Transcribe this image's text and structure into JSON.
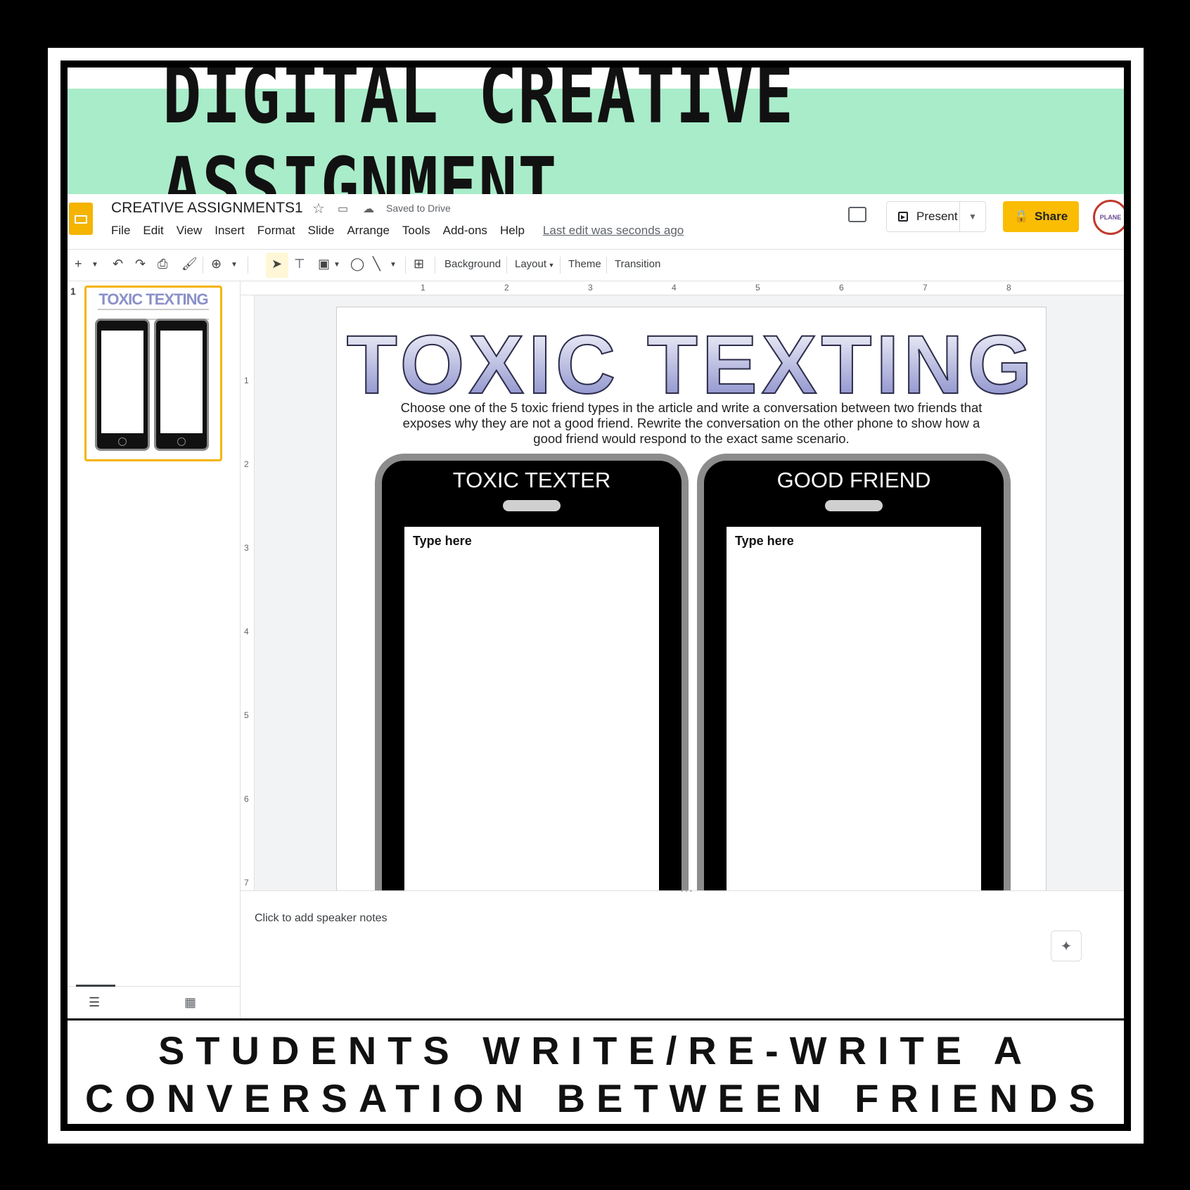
{
  "banner": {
    "title": "DIGITAL CREATIVE ASSIGNMENT"
  },
  "app": {
    "doc_title": "CREATIVE ASSIGNMENTS1",
    "saved_status": "Saved to Drive",
    "menu": [
      "File",
      "Edit",
      "View",
      "Insert",
      "Format",
      "Slide",
      "Arrange",
      "Tools",
      "Add-ons",
      "Help"
    ],
    "last_edit": "Last edit was seconds ago",
    "present_label": "Present",
    "share_label": "Share",
    "avatar_text": "PLANE",
    "toolbar": {
      "background": "Background",
      "layout": "Layout",
      "theme": "Theme",
      "transition": "Transition"
    },
    "ruler_h": [
      "1",
      "2",
      "3",
      "4",
      "5",
      "6",
      "7",
      "8"
    ],
    "ruler_v": [
      "1",
      "2",
      "3",
      "4",
      "5",
      "6",
      "7"
    ],
    "filmstrip": {
      "slide_number": "1",
      "thumb_title": "TOXIC TEXTING"
    },
    "slide": {
      "title": "TOXIC TEXTING",
      "instructions": "Choose one of the 5 toxic friend types in the article and write a conversation between two friends that exposes why they are not a good friend.  Rewrite the conversation on the other phone to show how a good friend would respond to the exact same scenario.",
      "phones": [
        {
          "label": "TOXIC TEXTER",
          "placeholder": "Type here"
        },
        {
          "label": "GOOD FRIEND",
          "placeholder": "Type here"
        }
      ]
    },
    "speaker_notes": "Click to add speaker notes"
  },
  "caption": {
    "line1": "STUDENTS WRITE/RE-WRITE A",
    "line2": "CONVERSATION BETWEEN FRIENDS"
  },
  "colors": {
    "banner_bg": "#a9ecc9",
    "share_bg": "#fbbc04",
    "slides_logo": "#f4b400",
    "title_gradient_bottom": "#7b80c4"
  }
}
